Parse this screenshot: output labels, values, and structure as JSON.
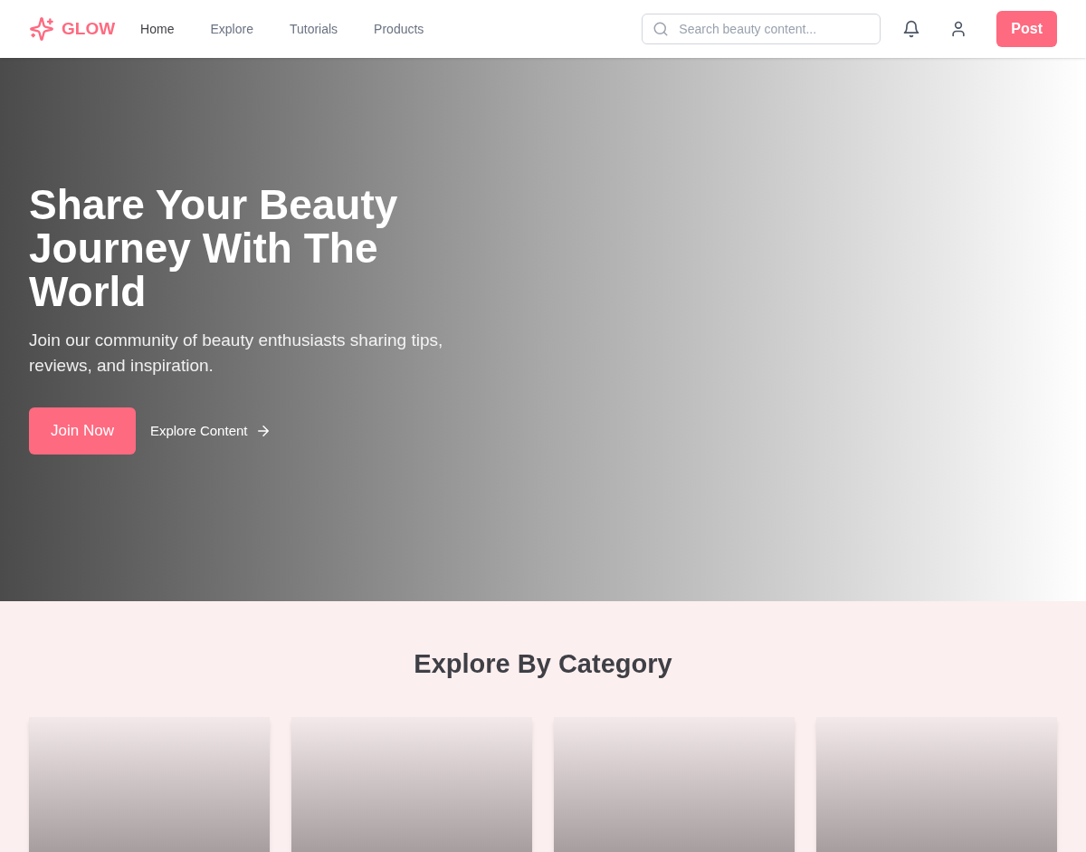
{
  "brand": {
    "name": "GLOW"
  },
  "nav": [
    {
      "label": "Home",
      "selected": true
    },
    {
      "label": "Explore",
      "selected": false
    },
    {
      "label": "Tutorials",
      "selected": false
    },
    {
      "label": "Products",
      "selected": false
    }
  ],
  "search": {
    "placeholder": "Search beauty content..."
  },
  "post_button": "Post",
  "hero": {
    "title": "Share Your Beauty Journey With The World",
    "subtitle": "Join our community of beauty enthusiasts sharing tips, reviews, and inspiration.",
    "primary_button": "Join Now",
    "secondary_link": "Explore Content"
  },
  "categories": {
    "title": "Explore By Category",
    "cards": [
      {
        "kind": "card"
      },
      {
        "kind": "card"
      },
      {
        "kind": "card"
      },
      {
        "kind": "card"
      }
    ]
  }
}
